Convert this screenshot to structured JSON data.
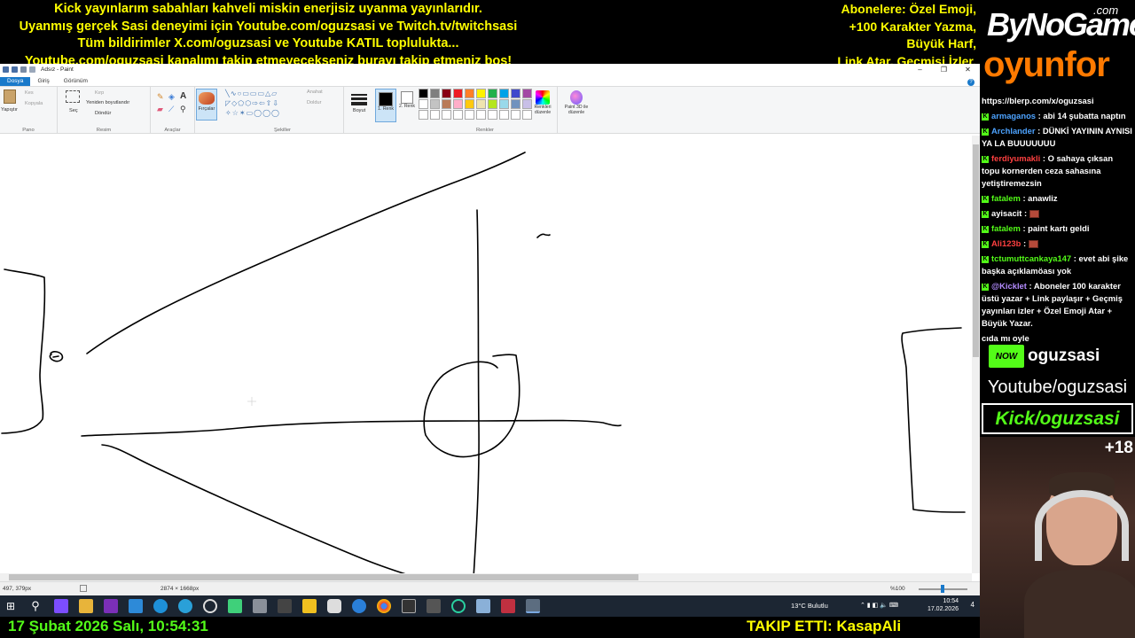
{
  "banner": {
    "lines": [
      "Kick yayınlarım sabahları kahveli miskin enerjisiz uyanma yayınlarıdır.",
      "Uyanmış gerçek Sasi deneyimi için Youtube.com/oguzsasi ve Twitch.tv/twitchsasi",
      "Tüm bildirimler X.com/oguzsasi ve Youtube KATIL toplulukta...",
      "Youtube.com/oguzsasi kanalımı takip etmeyecekseniz burayı takip etmeniz boş!"
    ],
    "right_lines": [
      "Abonelere: Özel Emoji,",
      "+100 Karakter Yazma,",
      "Büyük Harf,",
      "Link Atar, Geçmişi İzler."
    ]
  },
  "side": {
    "logo_main": "ByNoGame",
    "logo_com": ".com",
    "logo_sub": "oyunfor",
    "chat": [
      {
        "user": "",
        "text": "https://blerp.com/x/oguzsasi",
        "color": "#ffffff",
        "badge": false
      },
      {
        "user": "armaganos",
        "text": ": abi 14 şubatta naptın",
        "color": "#4da3ff",
        "badge": true
      },
      {
        "user": "Archlander",
        "text": ": DÜNKİ YAYININ AYNISI YA LA BUUUUUUU",
        "color": "#4da3ff",
        "badge": true
      },
      {
        "user": "ferdiyumakli",
        "text": ": O sahaya çıksan topu kornerden ceza sahasına yetiştiremezsin",
        "color": "#ff4040",
        "badge": true
      },
      {
        "user": "fatalem",
        "text": ": anawliz",
        "color": "#53fc18",
        "badge": true
      },
      {
        "user": "ayisacit",
        "text": ":",
        "color": "#ffffff",
        "badge": true,
        "emote": true
      },
      {
        "user": "fatalem",
        "text": ": paint kartı geldi",
        "color": "#53fc18",
        "badge": true
      },
      {
        "user": "Ali123b",
        "text": ":",
        "color": "#ff4040",
        "badge": true,
        "emote": true
      },
      {
        "user": "tctumuttcankaya147",
        "text": ": evet abi şike başka açıklamöası yok",
        "color": "#53fc18",
        "badge": true
      },
      {
        "user": "@Kicklet",
        "text": ": Aboneler 100 karakter üstü yazar + Link paylaşır + Geçmiş yayınları izler + Özel Emoji Atar + Büyük Yazar.",
        "color": "#b48cff",
        "badge": true
      },
      {
        "user": "",
        "text": "cıda mı oyle",
        "color": "#ffffff",
        "badge": false
      }
    ],
    "now_badge": "NOW",
    "now_name": "oguzsasi",
    "youtube": "Youtube/oguzsasi",
    "kick": "Kick/oguzsasi",
    "age": "+18"
  },
  "paint": {
    "title": "Adsız - Paint",
    "tabs": [
      "Dosya",
      "Giriş",
      "Görünüm"
    ],
    "groups": {
      "pano": "Pano",
      "resim": "Resim",
      "araclar": "Araçlar",
      "sekiller": "Şekiller",
      "renkler": "Renkler"
    },
    "labels": {
      "paste": "Yapıştır",
      "cut": "Kes",
      "copy": "Kopyala",
      "select": "Seç",
      "crop": "Kırp",
      "resize": "Yeniden boyutlandır",
      "rotate": "Döndür",
      "brushes": "Fırçalar",
      "outline": "Anahat",
      "fill": "Doldur",
      "size": "Boyut",
      "color1": "1. Renk",
      "color2": "2. Renk",
      "edit_colors": "Renkleri düzenle",
      "paint3d": "Paint 3D ile düzenle"
    },
    "palette": [
      "#000000",
      "#7f7f7f",
      "#880015",
      "#ed1c24",
      "#ff7f27",
      "#fff200",
      "#22b14c",
      "#00a2e8",
      "#3f48cc",
      "#a349a4",
      "#ffffff",
      "#c3c3c3",
      "#b97a57",
      "#ffaec9",
      "#ffc90e",
      "#efe4b0",
      "#b5e61d",
      "#99d9ea",
      "#7092be",
      "#c8bfe7",
      "#ffffff",
      "#ffffff",
      "#ffffff",
      "#ffffff",
      "#ffffff",
      "#ffffff",
      "#ffffff",
      "#ffffff",
      "#ffffff",
      "#ffffff"
    ],
    "status": {
      "cursor": "497, 379px",
      "size": "2874 × 1668px",
      "zoom": "%100"
    }
  },
  "taskbar": {
    "weather": "13°C  Bulutlu",
    "time": "10:54",
    "date": "17.02.2026",
    "notif": "4"
  },
  "bottom": {
    "datetime": "17 Şubat 2026 Salı, 10:54:31",
    "follow": "TAKIP ETTI: KasapAli"
  }
}
